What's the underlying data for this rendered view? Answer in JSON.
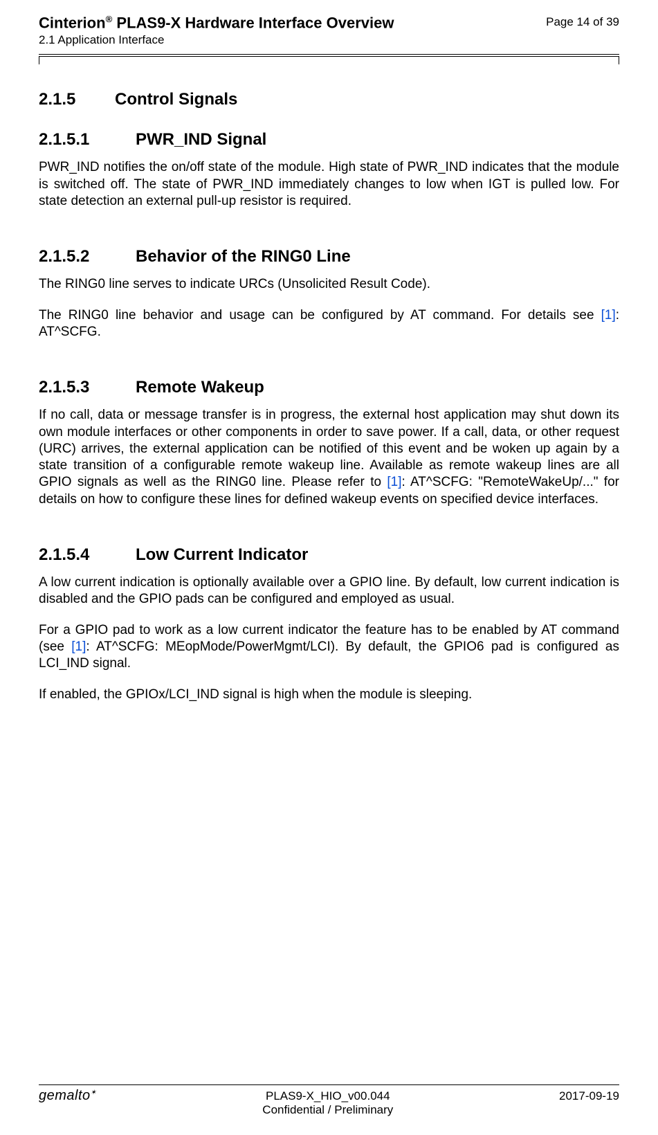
{
  "header": {
    "title_prefix": "Cinterion",
    "title_reg": "®",
    "title_suffix": " PLAS9-X Hardware Interface Overview",
    "section": "2.1 Application Interface",
    "page": "Page 14 of 39"
  },
  "sec215": {
    "num": "2.1.5",
    "title": "Control Signals"
  },
  "sec2151": {
    "num": "2.1.5.1",
    "title": "PWR_IND Signal",
    "p1": "PWR_IND notifies the on/off state of the module. High state of PWR_IND indicates that the module is switched off. The state of PWR_IND immediately changes to low when IGT is pulled low. For state detection an external pull-up resistor is required."
  },
  "sec2152": {
    "num": "2.1.5.2",
    "title": "Behavior of the RING0 Line",
    "p1": "The RING0 line serves to indicate URCs (Unsolicited Result Code).",
    "p2a": "The RING0 line behavior and usage can be configured by AT command. For details see ",
    "ref": "[1]",
    "p2b": ": AT^SCFG."
  },
  "sec2153": {
    "num": "2.1.5.3",
    "title": "Remote Wakeup",
    "p1a": "If no call, data or message transfer is in progress, the external host application may shut down its own module interfaces or other components in order to save power. If a call, data, or other request (URC) arrives, the external application can be notified of this event and be woken up again by a state transition of a configurable remote wakeup line. Available as remote wakeup lines are all GPIO signals as well as the RING0 line. Please refer to ",
    "ref": "[1]",
    "p1b": ": AT^SCFG: \"RemoteWakeUp/...\" for details on how to configure these lines for defined wakeup events on specified device interfaces."
  },
  "sec2154": {
    "num": "2.1.5.4",
    "title": "Low Current Indicator",
    "p1": "A low current indication is optionally available over a GPIO line. By default, low current indication is disabled and the GPIO pads can be configured and employed as usual.",
    "p2a": "For a GPIO pad to work as a low current indicator the feature has to be enabled by AT command (see ",
    "ref": "[1]",
    "p2b": ": AT^SCFG: MEopMode/PowerMgmt/LCI). By default, the GPIO6 pad is configured as LCI_IND signal.",
    "p3": "If enabled, the GPIOx/LCI_IND signal is high when the module is sleeping."
  },
  "footer": {
    "logo": "gemalto",
    "doc": "PLAS9-X_HIO_v00.044",
    "conf": "Confidential / Preliminary",
    "date": "2017-09-19"
  }
}
